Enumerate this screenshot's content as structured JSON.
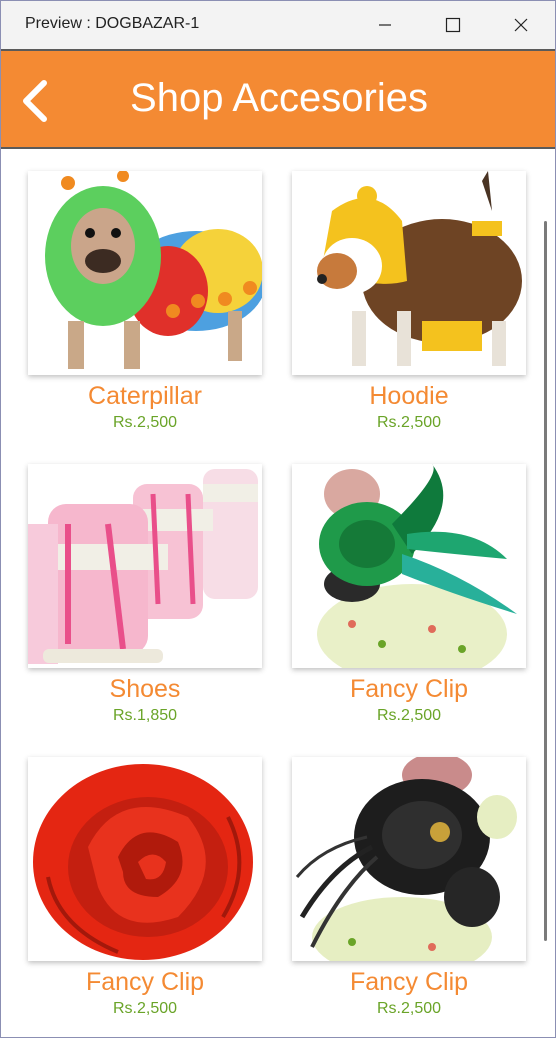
{
  "window": {
    "title": "Preview : DOGBAZAR-1",
    "controls": [
      "minimize-icon",
      "maximize-icon",
      "close-icon"
    ]
  },
  "header": {
    "title": "Shop Accesories",
    "back_icon": "chevron-left-icon",
    "color": "#f48a33"
  },
  "colors": {
    "name": "#f48a33",
    "price": "#6aa428"
  },
  "products": [
    {
      "name": "Caterpillar",
      "price": "Rs.2,500"
    },
    {
      "name": "Hoodie",
      "price": "Rs.2,500"
    },
    {
      "name": "Shoes",
      "price": "Rs.1,850"
    },
    {
      "name": "Fancy Clip",
      "price": "Rs.2,500"
    },
    {
      "name": "Fancy Clip",
      "price": "Rs.2,500"
    },
    {
      "name": "Fancy Clip",
      "price": "Rs.2,500"
    }
  ]
}
